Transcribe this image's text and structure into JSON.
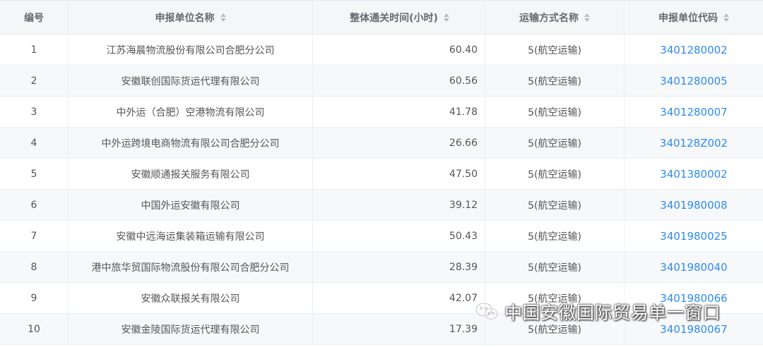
{
  "table": {
    "columns": [
      {
        "label": "编号",
        "sortable": false
      },
      {
        "label": "申报单位名称",
        "sortable": true
      },
      {
        "label": "整体通关时间(小时)",
        "sortable": true
      },
      {
        "label": "运输方式名称",
        "sortable": true
      },
      {
        "label": "申报单位代码",
        "sortable": true
      }
    ],
    "rows": [
      {
        "no": "1",
        "name": "江苏海晨物流股份有限公司合肥分公司",
        "hours": "60.40",
        "transport": "5(航空运输)",
        "code": "3401280002"
      },
      {
        "no": "2",
        "name": "安徽联创国际货运代理有限公司",
        "hours": "60.56",
        "transport": "5(航空运输)",
        "code": "3401280005"
      },
      {
        "no": "3",
        "name": "中外运（合肥）空港物流有限公司",
        "hours": "41.78",
        "transport": "5(航空运输)",
        "code": "3401280007"
      },
      {
        "no": "4",
        "name": "中外运跨境电商物流有限公司合肥分公司",
        "hours": "26.66",
        "transport": "5(航空运输)",
        "code": "340128Z002"
      },
      {
        "no": "5",
        "name": "安徽顺通报关服务有限公司",
        "hours": "47.50",
        "transport": "5(航空运输)",
        "code": "3401380002"
      },
      {
        "no": "6",
        "name": "中国外运安徽有限公司",
        "hours": "39.12",
        "transport": "5(航空运输)",
        "code": "3401980008"
      },
      {
        "no": "7",
        "name": "安徽中远海运集装箱运输有限公司",
        "hours": "50.43",
        "transport": "5(航空运输)",
        "code": "3401980025"
      },
      {
        "no": "8",
        "name": "港中旅华贸国际物流股份有限公司合肥分公司",
        "hours": "28.39",
        "transport": "5(航空运输)",
        "code": "3401980040"
      },
      {
        "no": "9",
        "name": "安徽众联报关有限公司",
        "hours": "42.07",
        "transport": "5(航空运输)",
        "code": "3401980066"
      },
      {
        "no": "10",
        "name": "安徽金陵国际货运代理有限公司",
        "hours": "17.39",
        "transport": "5(航空运输)",
        "code": "3401980067"
      }
    ]
  },
  "watermark": {
    "text": "中国安徽国际贸易单一窗口",
    "icon": "wechat-icon"
  },
  "colors": {
    "link": "#2d8cf0",
    "header_bg": "#f5f6f8",
    "stripe_bg": "#f7f8fa"
  }
}
